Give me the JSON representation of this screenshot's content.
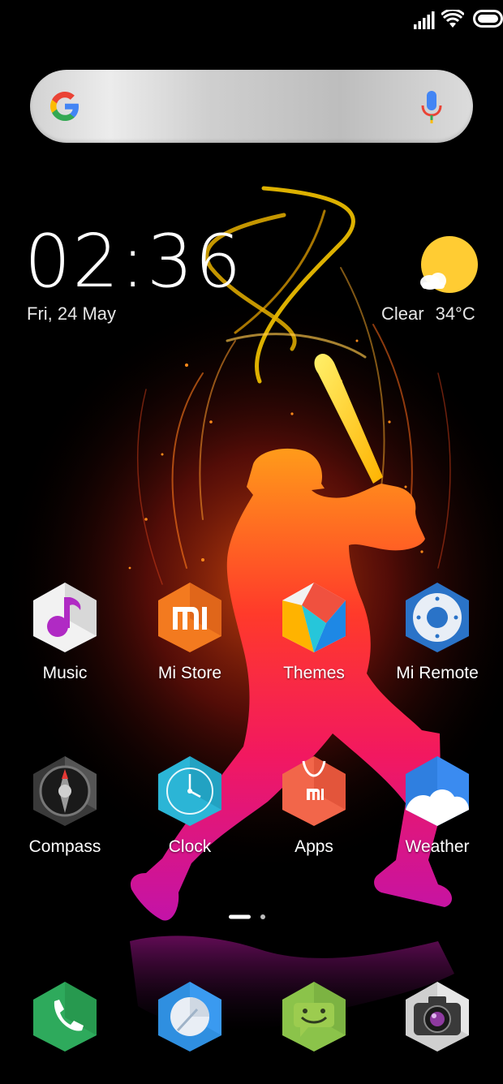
{
  "status_bar": {
    "signal_icon": "signal-bars-icon",
    "wifi_icon": "wifi-icon",
    "battery_icon": "battery-icon"
  },
  "search": {
    "logo_icon": "google-g-icon",
    "mic_icon": "microphone-icon"
  },
  "clock_widget": {
    "time": "02:36",
    "date": "Fri, 24 May"
  },
  "weather_widget": {
    "icon": "sun-cloud-icon",
    "condition": "Clear",
    "temperature": "34°C"
  },
  "apps": [
    {
      "label": "Music",
      "icon": "music-icon"
    },
    {
      "label": "Mi Store",
      "icon": "mi-store-icon"
    },
    {
      "label": "Themes",
      "icon": "themes-icon"
    },
    {
      "label": "Mi Remote",
      "icon": "mi-remote-icon"
    },
    {
      "label": "Compass",
      "icon": "compass-icon"
    },
    {
      "label": "Clock",
      "icon": "clock-icon"
    },
    {
      "label": "Apps",
      "icon": "apps-store-icon"
    },
    {
      "label": "Weather",
      "icon": "weather-icon"
    }
  ],
  "pager": {
    "page_count": 2,
    "current_page": 1
  },
  "dock": [
    {
      "icon": "phone-icon"
    },
    {
      "icon": "browser-icon"
    },
    {
      "icon": "messaging-icon"
    },
    {
      "icon": "camera-icon"
    }
  ],
  "colors": {
    "sun": "#ffcc33",
    "cricket_gradient_top": "#ff8a00",
    "cricket_gradient_mid": "#ff1744",
    "cricket_gradient_bottom": "#c2169c"
  }
}
